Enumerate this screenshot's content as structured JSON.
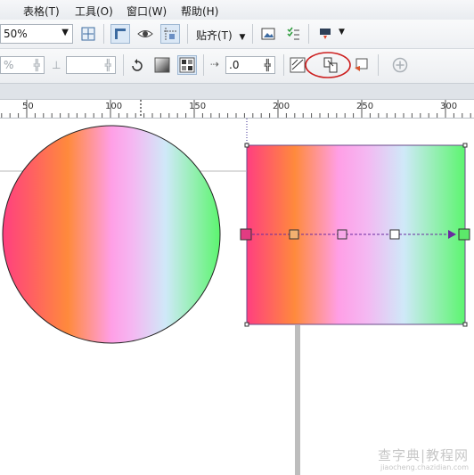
{
  "menu": {
    "table": "表格(T)",
    "tools": "工具(O)",
    "window": "窗口(W)",
    "help": "帮助(H)"
  },
  "toolbar": {
    "zoom_value": "50%",
    "snap_label": "贴齐(T)",
    "offset_value": ".0",
    "left_field_value": "%",
    "icons": [
      "zoom-fit-icon",
      "page-border-icon",
      "view-icon",
      "guides-icon",
      "snap-dropdown",
      "import-image-icon",
      "checklist-icon",
      "launcher-icon",
      "rotate-icon",
      "gradient-icon",
      "pattern-icon",
      "offset-icon",
      "copy-fill-icon",
      "copy-properties-icon",
      "edit-fill-icon",
      "add-icon"
    ]
  },
  "ruler": {
    "labels": [
      "50",
      "100",
      "150",
      "200",
      "250",
      "300"
    ]
  },
  "watermark": {
    "main": "查字典|教程网",
    "sub": "jiaocheng.chazidian.com"
  },
  "colors": {
    "gradient_stops": [
      "#ff3f80",
      "#ff8a3c",
      "#ff9fe6",
      "#f4b8f2",
      "#cfe9f8",
      "#5cf56f"
    ],
    "gradient_handle_start": "#e23b82",
    "gradient_handle_end": "#5ce86a",
    "gradient_line": "#6a2aa0",
    "highlight_circle": "#cc1f1f",
    "selection_square": "#8c3a8c"
  }
}
